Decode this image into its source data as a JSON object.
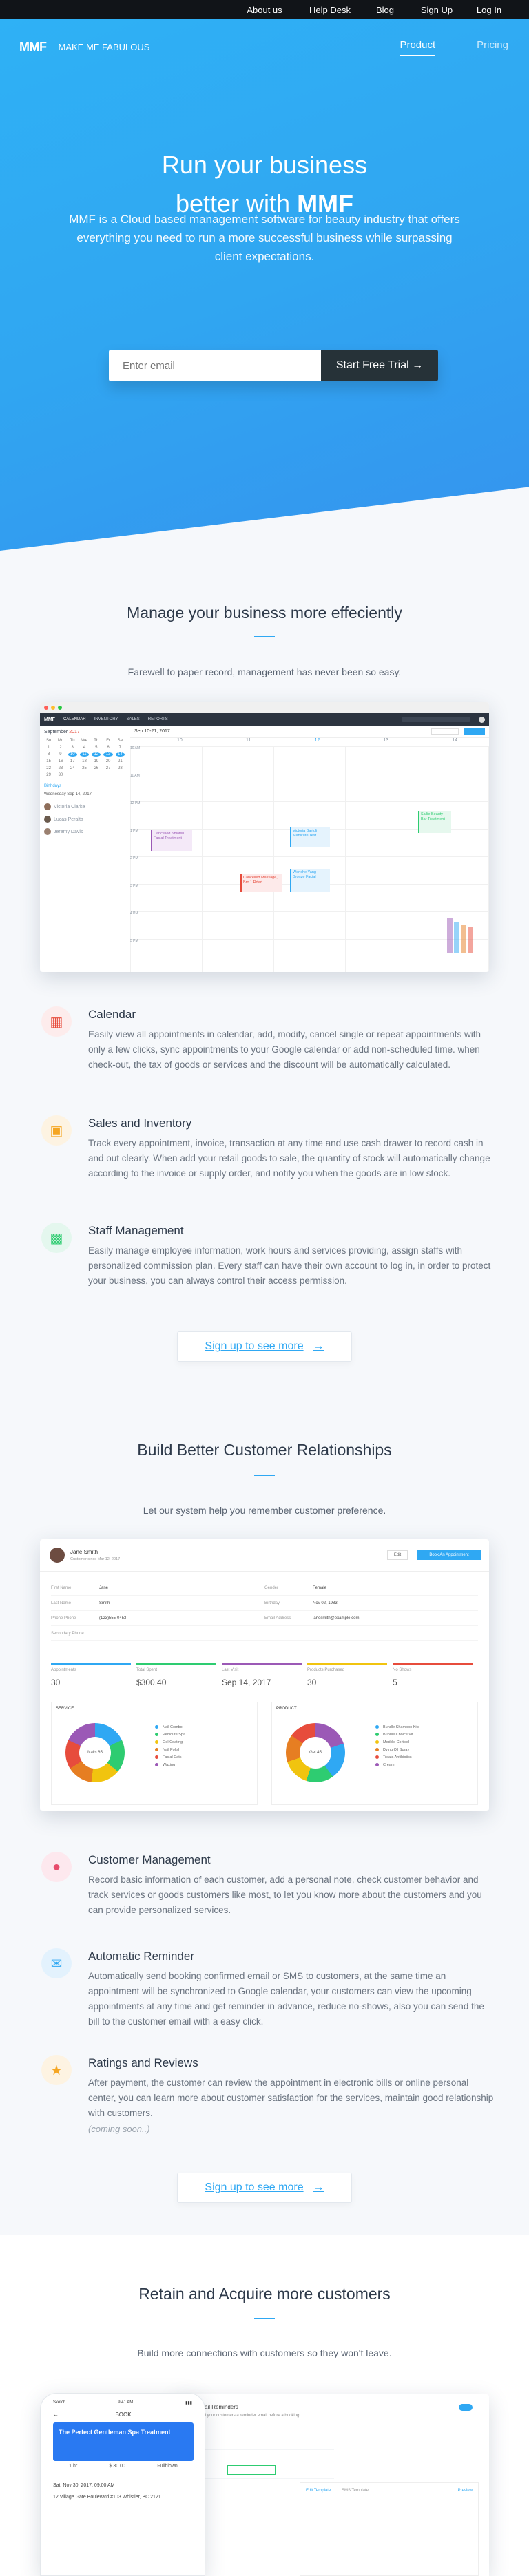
{
  "topnav": [
    "About us",
    "Help Desk",
    "Blog",
    "Sign Up",
    "Log In"
  ],
  "brand": {
    "logo": "MMF",
    "tagline": "MAKE ME FABULOUS"
  },
  "mainnav": {
    "product": "Product",
    "pricing": "Pricing"
  },
  "hero": {
    "line1": "Run your business",
    "line2_pre": "better with ",
    "line2_brand": "MMF",
    "subtitle": "MMF is a Cloud based management software for beauty industry that offers everything you need to run a more successful business while surpassing client expectations.",
    "email_placeholder": "Enter email",
    "cta": "Start Free Trial →"
  },
  "manage": {
    "title": "Manage your business more effeciently",
    "subtitle": "Farewell to paper record, management has never been so easy.",
    "features": [
      {
        "icon": "calendar-icon",
        "title": "Calendar",
        "text": "Easily view all appointments in calendar, add, modify, cancel single or repeat appointments with only a few clicks, sync appointments to your Google calendar or add non-scheduled time. when check-out, the tax of goods or services and the discount will be automatically calculated."
      },
      {
        "icon": "cash-register-icon",
        "title": "Sales and Inventory",
        "text": "Track every appointment, invoice, transaction at any time and use cash drawer to record cash in and out clearly. When add your retail goods to sale, the quantity of stock will automatically change according to the invoice or supply order, and notify you when the goods are in low stock."
      },
      {
        "icon": "staff-badge-icon",
        "title": "Staff Management",
        "text": "Easily manage employee information, work hours and services providing, assign staffs with personalized commission plan. Every staff can have their own account to log in, in order to protect your business, you can always control their access permission."
      }
    ],
    "cta": "Sign up to see more"
  },
  "calendar_mock": {
    "nav": [
      "CALENDAR",
      "INVENTORY",
      "SALES",
      "REPORTS"
    ],
    "month": "September",
    "year": "2017",
    "range": "Sep 10-21, 2017",
    "days": [
      "10",
      "11",
      "12",
      "13",
      "14"
    ],
    "times": [
      "10 AM",
      "11 AM",
      "12 PM",
      "1 PM",
      "2 PM",
      "3 PM",
      "4 PM",
      "5 PM"
    ],
    "section": "Birthdays",
    "date_label": "Wednesday Sep 14, 2017",
    "people": [
      "Victoria Clarke",
      "Lucas Peralta",
      "Jeremy Davis"
    ],
    "events": [
      {
        "label": "Cancelled Shiatsu Facial Treatment",
        "color": "#9b59b6"
      },
      {
        "label": "Victoria Bartoli Manicure Test",
        "color": "#2fa8f3"
      },
      {
        "label": "Cancelled Massage, Bro 1 Rdad",
        "color": "#e74c3c"
      },
      {
        "label": "Wenche Yang Bronze Facial",
        "color": "#2fa8f3"
      },
      {
        "label": "Sallie Beauty Bar Treatment",
        "color": "#2ecc71"
      }
    ]
  },
  "crm": {
    "title": "Build Better Customer Relationships",
    "subtitle": "Let our system help you remember customer preference.",
    "features": [
      {
        "icon": "customers-icon",
        "title": "Customer Management",
        "text": "Record basic information of each customer, add a personal note, check customer behavior and track services or goods customers like most, to let you know more about the customers and you can provide personalized services."
      },
      {
        "icon": "mail-icon",
        "title": "Automatic Reminder",
        "text": "Automatically send booking confirmed email or SMS to customers, at the same time an appointment will be synchronized to Google calendar, your customers can view the upcoming appointments at any time and get reminder in advance, reduce no-shows, also you can send the bill to the customer email with a easy click."
      },
      {
        "icon": "star-icon",
        "title": "Ratings and Reviews",
        "text": "After payment, the customer can review the appointment in electronic bills or online personal center, you can learn more about customer satisfaction for the services, maintain good relationship with customers."
      }
    ],
    "coming_soon": "(coming soon..)",
    "cta": "Sign up to see more"
  },
  "customer_mock": {
    "name": "Jane Smith",
    "since": "Customer since Mar 12, 2017",
    "edit": "Edit",
    "book": "Book An Appointment",
    "fields": [
      [
        "First Name",
        "Jane",
        "Gender",
        "Female"
      ],
      [
        "Last Name",
        "Smith",
        "Birthday",
        "Nov 02, 1983"
      ],
      [
        "Phone Phone",
        "(123)555-0453",
        "Email Address",
        "janesmith@example.com"
      ],
      [
        "Secondary Phone",
        "",
        "",
        ""
      ]
    ],
    "stats": [
      {
        "label": "Appointments",
        "value": "30",
        "color": "#2fa8f3"
      },
      {
        "label": "Total Spent",
        "value": "$300.40",
        "color": "#2ecc71"
      },
      {
        "label": "Last Visit",
        "value": "Sep 14, 2017",
        "color": "#9b59b6"
      },
      {
        "label": "Products Purchased",
        "value": "30",
        "color": "#f1c40f"
      },
      {
        "label": "No Shows",
        "value": "5",
        "color": "#e74c3c"
      }
    ],
    "service_label": "SERVICE",
    "product_label": "PRODUCT",
    "service_center": "Nails 65",
    "product_center": "Gel 45",
    "service_rows": [
      "Nail Combo",
      "Pedicure Spa",
      "Gel Coating",
      "Nail Polish",
      "Facial Cats",
      "Waxing"
    ],
    "product_rows": [
      "Bundle Shampoo Kits",
      "Bundle Choice Vit",
      "Meddle Cortisol",
      "Dying Oil Spray",
      "Treats Antibiotics",
      "Cream"
    ],
    "service_colors": [
      "#2fa8f3",
      "#2ecc71",
      "#f1c40f",
      "#e67e22",
      "#e74c3c",
      "#9b59b6"
    ]
  },
  "retain": {
    "title": "Retain and Acquire more customers",
    "subtitle": "Build more connections with customers so they won't leave."
  },
  "booking_mock": {
    "status": "9:41 AM",
    "carrier": "Sketch",
    "back": "BOOK",
    "card_title": "The Perfect Gentleman Spa Treatment",
    "duration": "1 hr",
    "price": "$ 30.00",
    "staff": "Fullblown",
    "date": "Sat, Nov 30, 2017, 09:00 AM",
    "address": "12 Village Gate Boulevard #103 Whistler, BC 2121",
    "admin_title": "Email Reminders",
    "admin_hint": "Send your customers a reminder email before a booking",
    "admin_tabs": [
      "Edit Template",
      "SMS Template"
    ],
    "admin_link": "Preview"
  }
}
